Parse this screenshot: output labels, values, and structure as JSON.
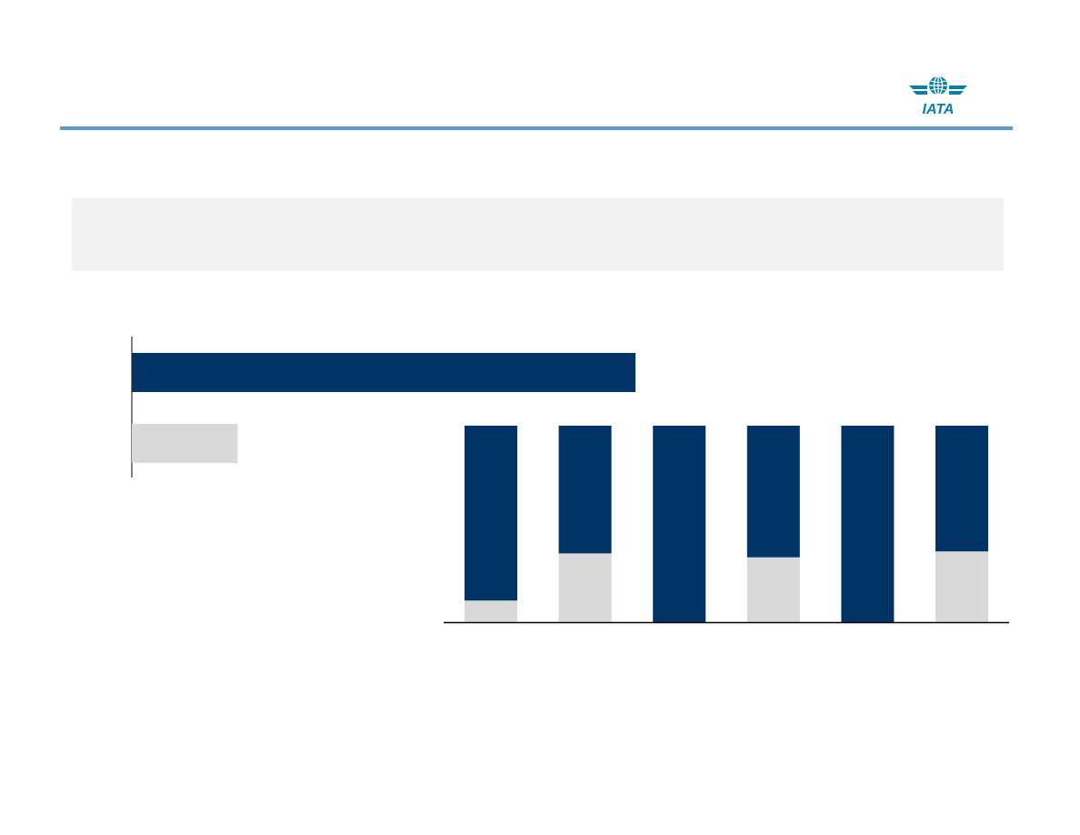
{
  "logo": {
    "text": "IATA"
  },
  "colors": {
    "navy": "#003366",
    "light_grey": "#d9d9d9",
    "rule_blue": "#5b9bd5",
    "box_grey": "#f2f2f2"
  },
  "chart_data": [
    {
      "type": "bar",
      "orientation": "horizontal",
      "categories": [
        "",
        ""
      ],
      "values": [
        100,
        21
      ],
      "colors": [
        "#003366",
        "#d9d9d9"
      ],
      "xlim": [
        0,
        100
      ]
    },
    {
      "type": "bar",
      "stacked": true,
      "categories": [
        "",
        "",
        "",
        "",
        "",
        ""
      ],
      "series": [
        {
          "values": [
            11,
            35,
            0,
            33,
            0,
            36
          ],
          "color": "#d9d9d9"
        },
        {
          "values": [
            89,
            65,
            100,
            67,
            100,
            64
          ],
          "color": "#003366"
        }
      ],
      "ylim": [
        0,
        100
      ]
    }
  ]
}
